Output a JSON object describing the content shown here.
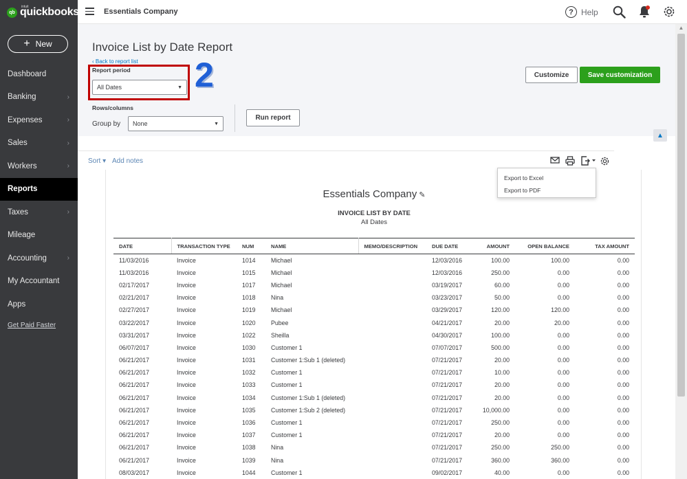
{
  "app": {
    "logo_small": "qb",
    "logo_intuit": "intuit",
    "logo_word": "quickbooks",
    "new_button": "New",
    "company_name": "Essentials Company",
    "help_label": "Help"
  },
  "sidebar": {
    "items": [
      {
        "label": "Dashboard",
        "chevron": false,
        "active": false
      },
      {
        "label": "Banking",
        "chevron": true,
        "active": false
      },
      {
        "label": "Expenses",
        "chevron": true,
        "active": false
      },
      {
        "label": "Sales",
        "chevron": true,
        "active": false
      },
      {
        "label": "Workers",
        "chevron": true,
        "active": false
      },
      {
        "label": "Reports",
        "chevron": false,
        "active": true
      },
      {
        "label": "Taxes",
        "chevron": true,
        "active": false
      },
      {
        "label": "Mileage",
        "chevron": false,
        "active": false
      },
      {
        "label": "Accounting",
        "chevron": true,
        "active": false
      },
      {
        "label": "My Accountant",
        "chevron": false,
        "active": false
      },
      {
        "label": "Apps",
        "chevron": false,
        "active": false
      }
    ],
    "get_paid_link": "Get Paid Faster"
  },
  "report_header": {
    "title": "Invoice List by Date Report",
    "back_link": "Back to report list",
    "period_label": "Report period",
    "period_value": "All Dates",
    "rows_columns_label": "Rows/columns",
    "group_by_label": "Group by",
    "group_by_value": "None",
    "run_report": "Run report",
    "customize": "Customize",
    "save_customization": "Save customization",
    "annotation_number": "2"
  },
  "toolbar": {
    "sort": "Sort",
    "add_notes": "Add notes",
    "export_menu": [
      "Export to Excel",
      "Export to PDF"
    ]
  },
  "report": {
    "company": "Essentials Company",
    "title": "INVOICE LIST BY DATE",
    "subtitle": "All Dates",
    "columns": [
      "DATE",
      "TRANSACTION TYPE",
      "NUM",
      "NAME",
      "MEMO/DESCRIPTION",
      "DUE DATE",
      "AMOUNT",
      "OPEN BALANCE",
      "TAX AMOUNT"
    ],
    "rows": [
      [
        "11/03/2016",
        "Invoice",
        "1014",
        "Michael",
        "",
        "12/03/2016",
        "100.00",
        "100.00",
        "0.00"
      ],
      [
        "11/03/2016",
        "Invoice",
        "1015",
        "Michael",
        "",
        "12/03/2016",
        "250.00",
        "0.00",
        "0.00"
      ],
      [
        "02/17/2017",
        "Invoice",
        "1017",
        "Michael",
        "",
        "03/19/2017",
        "60.00",
        "0.00",
        "0.00"
      ],
      [
        "02/21/2017",
        "Invoice",
        "1018",
        "Nina",
        "",
        "03/23/2017",
        "50.00",
        "0.00",
        "0.00"
      ],
      [
        "02/27/2017",
        "Invoice",
        "1019",
        "Michael",
        "",
        "03/29/2017",
        "120.00",
        "120.00",
        "0.00"
      ],
      [
        "03/22/2017",
        "Invoice",
        "1020",
        "Pubee",
        "",
        "04/21/2017",
        "20.00",
        "20.00",
        "0.00"
      ],
      [
        "03/31/2017",
        "Invoice",
        "1022",
        "Sheilla",
        "",
        "04/30/2017",
        "100.00",
        "0.00",
        "0.00"
      ],
      [
        "06/07/2017",
        "Invoice",
        "1030",
        "Customer 1",
        "",
        "07/07/2017",
        "500.00",
        "0.00",
        "0.00"
      ],
      [
        "06/21/2017",
        "Invoice",
        "1031",
        "Customer 1:Sub 1 (deleted)",
        "",
        "07/21/2017",
        "20.00",
        "0.00",
        "0.00"
      ],
      [
        "06/21/2017",
        "Invoice",
        "1032",
        "Customer 1",
        "",
        "07/21/2017",
        "10.00",
        "0.00",
        "0.00"
      ],
      [
        "06/21/2017",
        "Invoice",
        "1033",
        "Customer 1",
        "",
        "07/21/2017",
        "20.00",
        "0.00",
        "0.00"
      ],
      [
        "06/21/2017",
        "Invoice",
        "1034",
        "Customer 1:Sub 1 (deleted)",
        "",
        "07/21/2017",
        "20.00",
        "0.00",
        "0.00"
      ],
      [
        "06/21/2017",
        "Invoice",
        "1035",
        "Customer 1:Sub 2 (deleted)",
        "",
        "07/21/2017",
        "10,000.00",
        "0.00",
        "0.00"
      ],
      [
        "06/21/2017",
        "Invoice",
        "1036",
        "Customer 1",
        "",
        "07/21/2017",
        "250.00",
        "0.00",
        "0.00"
      ],
      [
        "06/21/2017",
        "Invoice",
        "1037",
        "Customer 1",
        "",
        "07/21/2017",
        "20.00",
        "0.00",
        "0.00"
      ],
      [
        "06/21/2017",
        "Invoice",
        "1038",
        "Nina",
        "",
        "07/21/2017",
        "250.00",
        "250.00",
        "0.00"
      ],
      [
        "06/21/2017",
        "Invoice",
        "1039",
        "Nina",
        "",
        "07/21/2017",
        "360.00",
        "360.00",
        "0.00"
      ],
      [
        "08/03/2017",
        "Invoice",
        "1044",
        "Customer 1",
        "",
        "09/02/2017",
        "40.00",
        "0.00",
        "0.00"
      ]
    ]
  },
  "colors": {
    "sidebar_bg": "#393a3d",
    "brand_green": "#2ca01c",
    "link_blue": "#0077c5",
    "highlight_red": "#c00000",
    "annotation_blue": "#1f5fd6"
  }
}
